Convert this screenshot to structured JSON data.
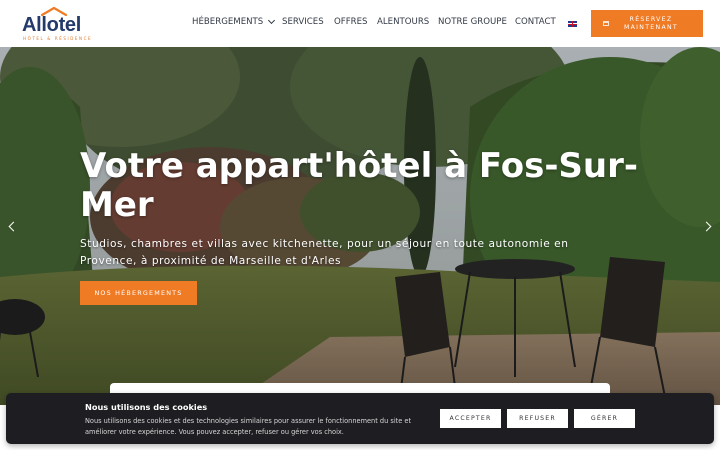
{
  "header": {
    "logo": {
      "name": "Allotel",
      "tagline": "HÔTEL & RÉSIDENCE"
    },
    "nav": [
      {
        "label": "HÉBERGEMENTS",
        "has_dropdown": true
      },
      {
        "label": "SERVICES"
      },
      {
        "label": "OFFRES"
      },
      {
        "label": "ALENTOURS"
      },
      {
        "label": "NOTRE GROUPE"
      },
      {
        "label": "CONTACT"
      }
    ],
    "language_icon": "uk-flag-icon",
    "reserve_label": "RÉSERVEZ MAINTENANT"
  },
  "hero": {
    "title": "Votre appart'hôtel à Fos-Sur-Mer",
    "subtitle": "Studios, chambres et villas avec kitchenette, pour un séjour en toute autonomie en Provence, à proximité de Marseille et d'Arles",
    "cta_label": "NOS HÉBERGEMENTS",
    "prev_icon": "chevron-left-icon",
    "next_icon": "chevron-right-icon"
  },
  "cookie_banner": {
    "title": "Nous utilisons des cookies",
    "text": "Nous utilisons des cookies et des technologies similaires pour assurer le fonctionnement du site et améliorer votre expérience. Vous pouvez accepter, refuser ou gérer vos choix.",
    "accept_label": "ACCEPTER",
    "refuse_label": "REFUSER",
    "manage_label": "GÉRER"
  },
  "colors": {
    "accent": "#f07b25",
    "brand_navy": "#233a6b",
    "banner_bg": "#1e1e22"
  }
}
